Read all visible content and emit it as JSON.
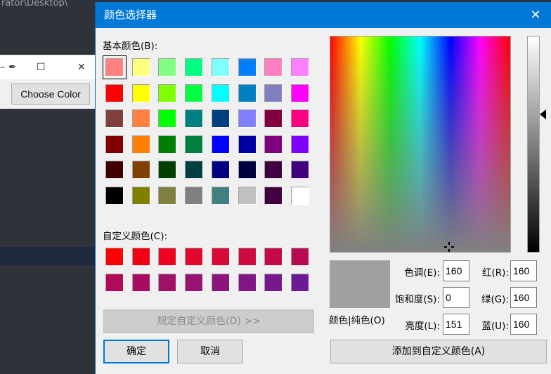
{
  "background": {
    "title_fragment_left": "rator\\Desktop\\",
    "title_fragment_right": "",
    "small_window": {
      "choose_button_label": "Choose Color"
    }
  },
  "dialog": {
    "title": "颜色选择器",
    "basic_colors_label": "基本颜色(B):",
    "custom_colors_label": "自定义颜色(C):",
    "define_custom_button": "规定自定义颜色(D) >>",
    "ok_button": "确定",
    "cancel_button": "取消",
    "add_custom_button": "添加到自定义颜色(A)",
    "color_solid_label": "颜色|纯色(O)",
    "fields": {
      "hue": {
        "label": "色调(E):",
        "value": "160"
      },
      "sat": {
        "label": "饱和度(S):",
        "value": "0"
      },
      "lum": {
        "label": "亮度(L):",
        "value": "151"
      },
      "red": {
        "label": "红(R):",
        "value": "160"
      },
      "green": {
        "label": "绿(G):",
        "value": "160"
      },
      "blue": {
        "label": "蓝(U):",
        "value": "160"
      }
    },
    "current_color": "#a0a0a0",
    "basic_colors": [
      [
        "#ff8080",
        "#ffff80",
        "#80ff80",
        "#00ff80",
        "#80ffff",
        "#0080ff",
        "#ff80c0",
        "#ff80ff"
      ],
      [
        "#ff0000",
        "#ffff00",
        "#80ff00",
        "#00ff40",
        "#00ffff",
        "#0080c0",
        "#8080c0",
        "#ff00ff"
      ],
      [
        "#804040",
        "#ff8040",
        "#00ff00",
        "#008080",
        "#004080",
        "#8080ff",
        "#800040",
        "#ff0080"
      ],
      [
        "#800000",
        "#ff8000",
        "#008000",
        "#008040",
        "#0000ff",
        "#0000a0",
        "#800080",
        "#8000ff"
      ],
      [
        "#400000",
        "#804000",
        "#004000",
        "#004040",
        "#000080",
        "#000040",
        "#400040",
        "#400080"
      ],
      [
        "#000000",
        "#808000",
        "#808040",
        "#808080",
        "#408080",
        "#c0c0c0",
        "#400040",
        "#ffffff"
      ]
    ],
    "custom_colors": [
      [
        "#ff0000",
        "#f00012",
        "#ec0420",
        "#e0082e",
        "#d80a38",
        "#cc0c40",
        "#c40848",
        "#b80a4e"
      ],
      [
        "#b00a58",
        "#a80c60",
        "#a01068",
        "#981472",
        "#8c147c",
        "#821684",
        "#76188c",
        "#6c1a94"
      ]
    ]
  }
}
